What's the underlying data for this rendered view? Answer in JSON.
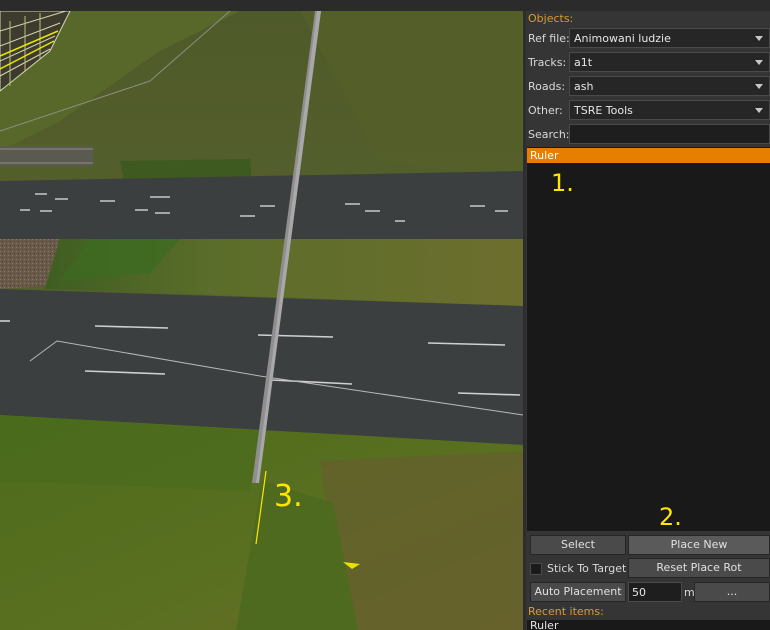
{
  "viewport": {
    "annotation_3": "3."
  },
  "panel": {
    "objects_label": "Objects:",
    "ref_file": {
      "label": "Ref file:",
      "value": "Animowani ludzie"
    },
    "tracks": {
      "label": "Tracks:",
      "value": "a1t"
    },
    "roads": {
      "label": "Roads:",
      "value": "ash"
    },
    "other": {
      "label": "Other:",
      "value": "TSRE Tools"
    },
    "search": {
      "label": "Search:",
      "value": ""
    },
    "object_list": {
      "items": [
        {
          "label": "Ruler",
          "selected": true
        }
      ],
      "annotation_1": "1.",
      "annotation_2": "2."
    },
    "buttons": {
      "select": "Select",
      "place_new": "Place New",
      "stick_to_target": "Stick To Target",
      "reset_place_rot": "Reset Place Rot",
      "auto_placement": "Auto Placement",
      "distance_value": "50",
      "distance_unit": "m",
      "more": "..."
    },
    "recent_items": {
      "label": "Recent items:",
      "items": [
        "Ruler"
      ]
    }
  },
  "colors": {
    "selection": "#e67e00",
    "annotation": "#ffe600",
    "panel_bg": "#353535",
    "list_bg": "#191919",
    "label_orange": "#d89a3a"
  }
}
